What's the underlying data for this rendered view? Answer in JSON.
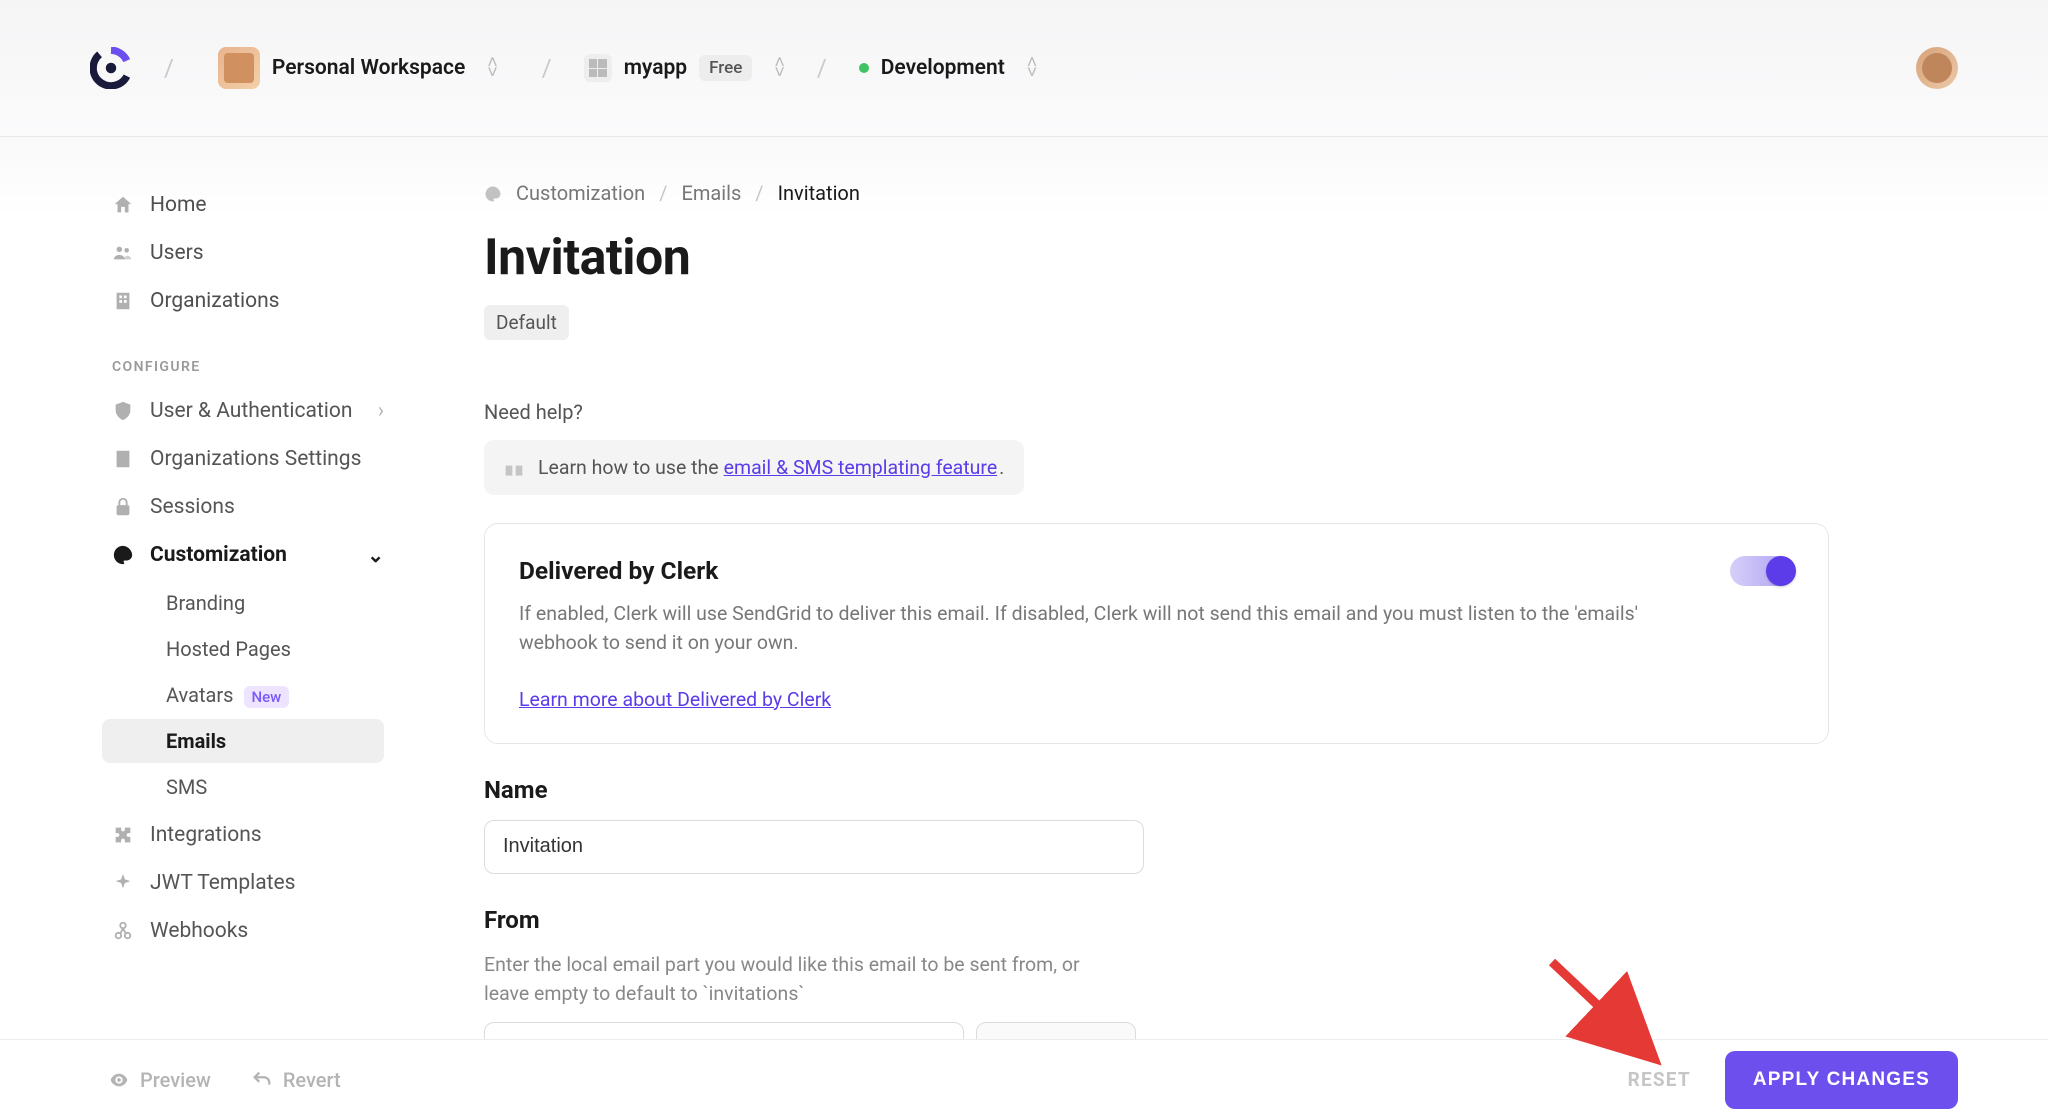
{
  "topbar": {
    "workspace_label": "Personal Workspace",
    "app_name": "myapp",
    "free_pill": "Free",
    "env_name": "Development"
  },
  "sidebar": {
    "primary": [
      {
        "label": "Home"
      },
      {
        "label": "Users"
      },
      {
        "label": "Organizations"
      }
    ],
    "configure_label": "CONFIGURE",
    "configure": [
      {
        "label": "User & Authentication"
      },
      {
        "label": "Organizations Settings"
      },
      {
        "label": "Sessions"
      },
      {
        "label": "Customization"
      },
      {
        "label": "Integrations"
      },
      {
        "label": "JWT Templates"
      },
      {
        "label": "Webhooks"
      }
    ],
    "customization_sub": [
      {
        "label": "Branding"
      },
      {
        "label": "Hosted Pages"
      },
      {
        "label": "Avatars",
        "badge": "New"
      },
      {
        "label": "Emails"
      },
      {
        "label": "SMS"
      }
    ]
  },
  "breadcrumbs": {
    "items": [
      "Customization",
      "Emails",
      "Invitation"
    ]
  },
  "page": {
    "title": "Invitation",
    "tag": "Default",
    "need_help_label": "Need help?",
    "help_prefix": "Learn how to use the ",
    "help_link_text": "email & SMS templating feature",
    "help_suffix": "."
  },
  "delivered_panel": {
    "title": "Delivered by Clerk",
    "desc": "If enabled, Clerk will use SendGrid to deliver this email. If disabled, Clerk will not send this email and you must listen to the 'emails' webhook to send it on your own.",
    "link_text": "Learn more about Delivered by Clerk",
    "enabled": true
  },
  "form": {
    "name_label": "Name",
    "name_value": "Invitation",
    "from_label": "From",
    "from_helper": "Enter the local email part you would like this email to be sent from, or leave empty to default to `invitations`"
  },
  "bottombar": {
    "preview": "Preview",
    "revert": "Revert",
    "reset": "RESET",
    "apply": "APPLY CHANGES"
  },
  "colors": {
    "accent": "#6d4fee",
    "link": "#5b3ce8",
    "green": "#40c463"
  }
}
